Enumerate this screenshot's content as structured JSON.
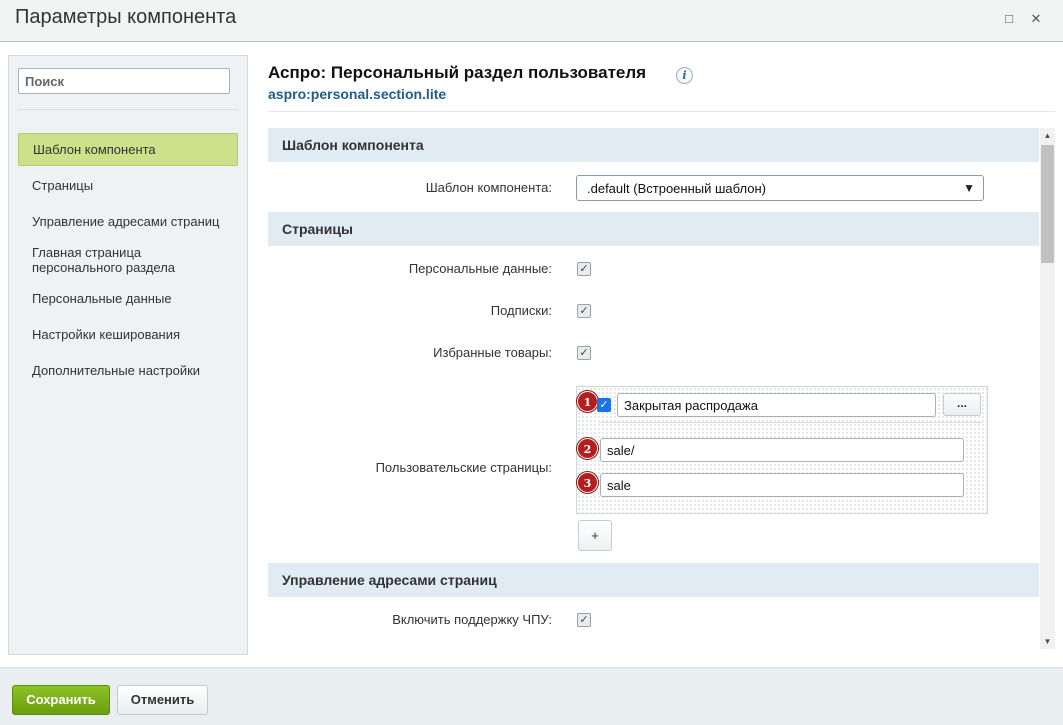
{
  "window": {
    "title": "Параметры компонента",
    "maximize_glyph": "□",
    "close_glyph": "✕"
  },
  "sidebar": {
    "search_placeholder": "Поиск",
    "items": [
      {
        "label": "Шаблон компонента",
        "active": true
      },
      {
        "label": "Страницы"
      },
      {
        "label": "Управление адресами страниц"
      },
      {
        "label": "Главная страница персонального раздела"
      },
      {
        "label": "Персональные данные"
      },
      {
        "label": "Настройки кеширования"
      },
      {
        "label": "Дополнительные настройки"
      }
    ]
  },
  "header": {
    "title": "Аспро: Персональный раздел пользователя",
    "info_glyph": "i",
    "code": "aspro:personal.section.lite"
  },
  "sections": {
    "template": {
      "title": "Шаблон компонента",
      "field_label": "Шаблон компонента:",
      "select_value": ".default (Встроенный шаблон)"
    },
    "pages": {
      "title": "Страницы",
      "personal_data": {
        "label": "Персональные данные:",
        "checked": true
      },
      "subscriptions": {
        "label": "Подписки:",
        "checked": true
      },
      "favorites": {
        "label": "Избранные товары:",
        "checked": true
      },
      "custom_pages": {
        "label": "Пользовательские страницы:",
        "entry": {
          "enabled": true,
          "name": "Закрытая распродажа",
          "path": "sale/",
          "code": "sale"
        },
        "browse_label": "...",
        "add_label": "+",
        "badges": [
          "1",
          "2",
          "3"
        ]
      }
    },
    "urls": {
      "title": "Управление адресами страниц",
      "sef": {
        "label": "Включить поддержку ЧПУ:",
        "checked": true
      }
    }
  },
  "footer": {
    "save_label": "Сохранить",
    "cancel_label": "Отменить"
  },
  "colors": {
    "accent_green": "#7cb31a",
    "active_nav": "#cde18a",
    "section_bg": "#e1ebf3",
    "link_blue": "#1f5e8b",
    "badge_red": "#b51e1e"
  }
}
